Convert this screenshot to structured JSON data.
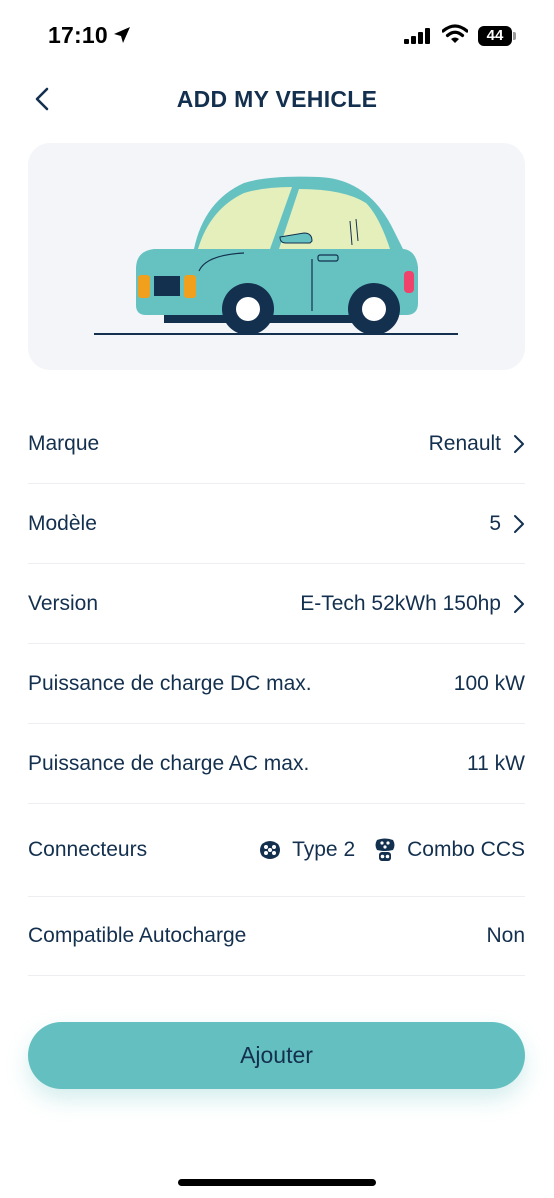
{
  "status_bar": {
    "time": "17:10",
    "battery": "44"
  },
  "header": {
    "title": "ADD MY VEHICLE"
  },
  "vehicle": {
    "rows": [
      {
        "label": "Marque",
        "value": "Renault"
      },
      {
        "label": "Modèle",
        "value": "5"
      },
      {
        "label": "Version",
        "value": "E-Tech 52kWh 150hp"
      },
      {
        "label": "Puissance de charge DC max.",
        "value": "100 kW"
      },
      {
        "label": "Puissance de charge AC max.",
        "value": "11 kW"
      },
      {
        "label": "Connecteurs",
        "connectors": [
          "Type 2",
          "Combo CCS"
        ]
      },
      {
        "label": "Compatible Autocharge",
        "value": "Non"
      }
    ]
  },
  "actions": {
    "add_label": "Ajouter"
  },
  "colors": {
    "accent": "#64c0c0",
    "text": "#14304f",
    "card": "#f3f5f8"
  },
  "icons": [
    "location-arrow-icon",
    "signal-icon",
    "wifi-icon",
    "battery-icon",
    "back-chevron-icon",
    "chevron-right-icon",
    "type2-connector-icon",
    "ccs-connector-icon"
  ]
}
